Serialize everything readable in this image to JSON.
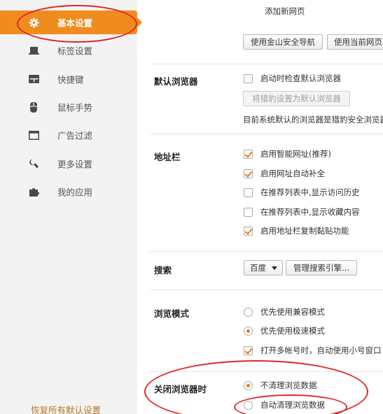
{
  "sidebar": {
    "items": [
      {
        "label": "基本设置",
        "icon": "gear-icon",
        "active": true
      },
      {
        "label": "标签设置",
        "icon": "tab-icon"
      },
      {
        "label": "快捷键",
        "icon": "keyboard-icon"
      },
      {
        "label": "鼠标手势",
        "icon": "mouse-icon"
      },
      {
        "label": "广告过滤",
        "icon": "window-icon"
      },
      {
        "label": "更多设置",
        "icon": "wrench-icon"
      },
      {
        "label": "我的应用",
        "icon": "puzzle-icon"
      }
    ],
    "restore_label": "恢复所有默认设置"
  },
  "colors": {
    "accent": "#f08c1e",
    "check": "#e07d20",
    "annotation": "#e0262a",
    "link": "#b47a2a"
  },
  "startup": {
    "add_new_page": "添加新网页",
    "use_jinshan_nav": "使用金山安全导航",
    "use_current_page": "使用当前网页"
  },
  "default_browser": {
    "title": "默认浏览器",
    "check_on_start": "启动时检查默认浏览器",
    "set_default_button": "将猎豹设置为默认浏览器",
    "status_text": "目前系统默认的浏览器是猎豹安全浏览器"
  },
  "address_bar": {
    "title": "地址栏",
    "options": [
      {
        "label": "启用智能网址(推荐)",
        "checked": true
      },
      {
        "label": "启用网址自动补全",
        "checked": true
      },
      {
        "label": "在推荐列表中,显示访问历史",
        "checked": false
      },
      {
        "label": "在推荐列表中,显示收藏内容",
        "checked": false
      },
      {
        "label": "启用地址栏复制黏贴功能",
        "checked": true
      }
    ]
  },
  "search": {
    "title": "搜索",
    "engine": "百度",
    "manage_button": "管理搜索引擎..."
  },
  "browse_mode": {
    "title": "浏览模式",
    "options": [
      {
        "label": "优先使用兼容模式",
        "selected": false
      },
      {
        "label": "优先使用极速模式",
        "selected": true
      }
    ],
    "multi_account": {
      "label": "打开多帐号时，自动使用小号窗口",
      "checked": true
    }
  },
  "on_close": {
    "title": "关闭浏览器时",
    "options": [
      {
        "label": "不清理浏览数据",
        "selected": true
      },
      {
        "label": "自动清理浏览数据",
        "selected": false
      }
    ]
  }
}
